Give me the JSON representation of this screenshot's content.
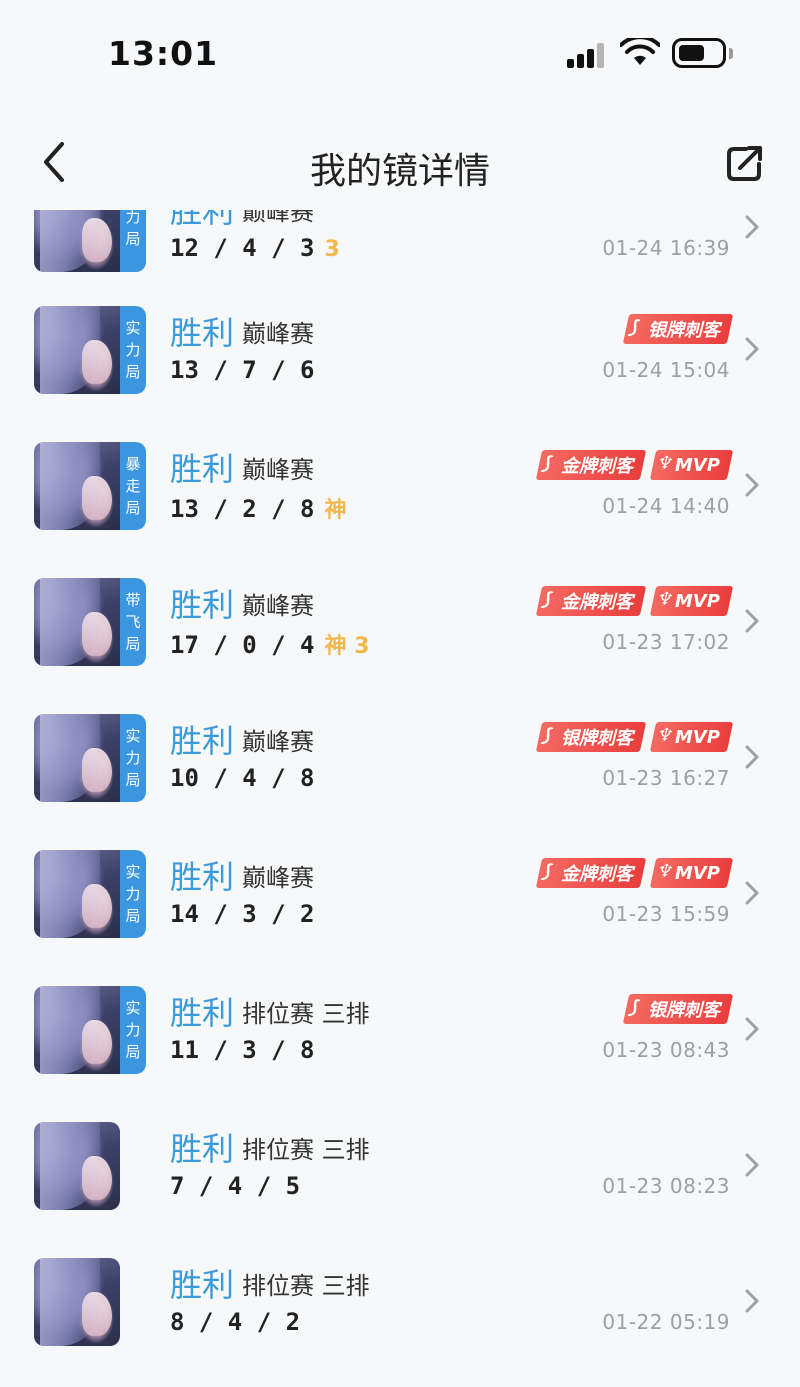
{
  "status_bar": {
    "time": "13:01"
  },
  "nav": {
    "title": "我的镜详情"
  },
  "matches": [
    {
      "result": "胜利",
      "mode": "巅峰赛",
      "kda": "12 / 4 / 3",
      "streak": "3",
      "tag": [
        "力",
        "局"
      ],
      "badges": [],
      "time": "01-24 16:39"
    },
    {
      "result": "胜利",
      "mode": "巅峰赛",
      "kda": "13 / 7 / 6",
      "streak": "",
      "tag": [
        "实",
        "力",
        "局"
      ],
      "badges": [
        "银牌刺客"
      ],
      "time": "01-24 15:04"
    },
    {
      "result": "胜利",
      "mode": "巅峰赛",
      "kda": "13 / 2 / 8",
      "streak": "神",
      "tag": [
        "暴",
        "走",
        "局"
      ],
      "badges": [
        "金牌刺客",
        "MVP"
      ],
      "time": "01-24 14:40"
    },
    {
      "result": "胜利",
      "mode": "巅峰赛",
      "kda": "17 / 0 / 4",
      "streak": "神 3",
      "tag": [
        "带",
        "飞",
        "局"
      ],
      "badges": [
        "金牌刺客",
        "MVP"
      ],
      "time": "01-23 17:02"
    },
    {
      "result": "胜利",
      "mode": "巅峰赛",
      "kda": "10 / 4 / 8",
      "streak": "",
      "tag": [
        "实",
        "力",
        "局"
      ],
      "badges": [
        "银牌刺客",
        "MVP"
      ],
      "time": "01-23 16:27"
    },
    {
      "result": "胜利",
      "mode": "巅峰赛",
      "kda": "14 / 3 / 2",
      "streak": "",
      "tag": [
        "实",
        "力",
        "局"
      ],
      "badges": [
        "金牌刺客",
        "MVP"
      ],
      "time": "01-23 15:59"
    },
    {
      "result": "胜利",
      "mode": "排位赛 三排",
      "kda": "11 / 3 / 8",
      "streak": "",
      "tag": [
        "实",
        "力",
        "局"
      ],
      "badges": [
        "银牌刺客"
      ],
      "time": "01-23 08:43"
    },
    {
      "result": "胜利",
      "mode": "排位赛 三排",
      "kda": "7 / 4 / 5",
      "streak": "",
      "tag": [],
      "badges": [],
      "time": "01-23 08:23"
    },
    {
      "result": "胜利",
      "mode": "排位赛 三排",
      "kda": "8 / 4 / 2",
      "streak": "",
      "tag": [],
      "badges": [],
      "time": "01-22 05:19"
    }
  ],
  "colors": {
    "result": "#3a9ad9",
    "tag_bg": "#3d97e0",
    "badge": "#ea3d3d",
    "streak": "#f3b84a",
    "time": "#9aa0a6"
  },
  "icons": {
    "back": "chevron-left-icon",
    "share": "share-icon",
    "row": "chevron-right-icon",
    "badge_mvp": "trophy-icon",
    "badge_assassin": "blade-icon"
  }
}
